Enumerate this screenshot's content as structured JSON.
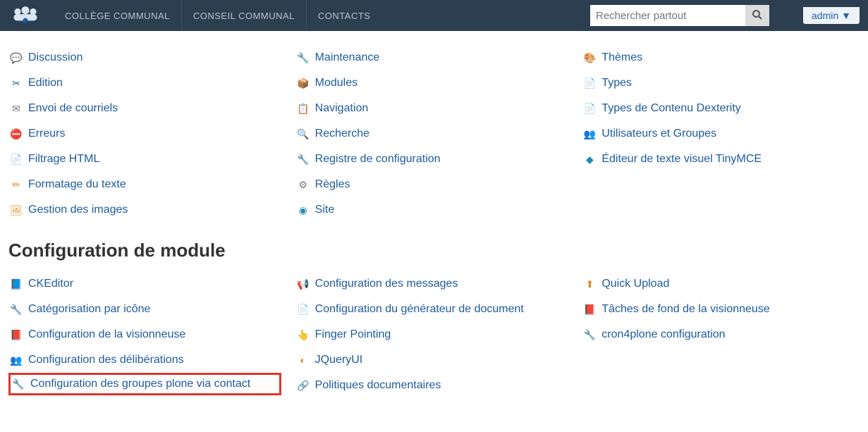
{
  "header": {
    "nav": [
      "COLLÈGE COMMUNAL",
      "CONSEIL COMMUNAL",
      "CONTACTS"
    ],
    "search_placeholder": "Rechercher partout",
    "user": "admin"
  },
  "section1": {
    "col1": [
      {
        "icon": "💬",
        "cls": "ic-blue",
        "name": "discussion",
        "label": "Discussion"
      },
      {
        "icon": "✂",
        "cls": "ic-blue",
        "name": "edition",
        "label": "Edition"
      },
      {
        "icon": "✉",
        "cls": "ic-grey",
        "name": "envoi-courriels",
        "label": "Envoi de courriels"
      },
      {
        "icon": "⛔",
        "cls": "ic-red",
        "name": "erreurs",
        "label": "Erreurs"
      },
      {
        "icon": "📄",
        "cls": "ic-blue",
        "name": "filtrage-html",
        "label": "Filtrage HTML"
      },
      {
        "icon": "✏",
        "cls": "ic-orange",
        "name": "formatage-texte",
        "label": "Formatage du texte"
      },
      {
        "icon": "🖼",
        "cls": "ic-orange",
        "name": "gestion-images",
        "label": "Gestion des images"
      }
    ],
    "col2": [
      {
        "icon": "🔧",
        "cls": "ic-wrench",
        "name": "maintenance",
        "label": "Maintenance"
      },
      {
        "icon": "📦",
        "cls": "ic-orange",
        "name": "modules",
        "label": "Modules"
      },
      {
        "icon": "📋",
        "cls": "ic-grey",
        "name": "navigation",
        "label": "Navigation"
      },
      {
        "icon": "🔍",
        "cls": "ic-grey",
        "name": "recherche",
        "label": "Recherche"
      },
      {
        "icon": "🔧",
        "cls": "ic-wrench",
        "name": "registre-config",
        "label": "Registre de configuration"
      },
      {
        "icon": "⚙",
        "cls": "ic-grey",
        "name": "regles",
        "label": "Règles"
      },
      {
        "icon": "◉",
        "cls": "ic-teal",
        "name": "site",
        "label": "Site"
      }
    ],
    "col3": [
      {
        "icon": "🎨",
        "cls": "ic-blue",
        "name": "themes",
        "label": "Thèmes"
      },
      {
        "icon": "📄",
        "cls": "ic-blue",
        "name": "types",
        "label": "Types"
      },
      {
        "icon": "📄",
        "cls": "ic-blue",
        "name": "types-dexterity",
        "label": "Types de Contenu Dexterity"
      },
      {
        "icon": "👥",
        "cls": "ic-orange",
        "name": "users-groups",
        "label": "Utilisateurs et Groupes"
      },
      {
        "icon": "◆",
        "cls": "ic-teal",
        "name": "tinymce",
        "label": "Éditeur de texte visuel TinyMCE"
      }
    ]
  },
  "section2": {
    "title": "Configuration de module",
    "col1": [
      {
        "icon": "📘",
        "cls": "ic-teal",
        "name": "ckeditor",
        "label": "CKEditor"
      },
      {
        "icon": "🔧",
        "cls": "ic-wrench",
        "name": "categorisation-icone",
        "label": "Catégorisation par icône"
      },
      {
        "icon": "📕",
        "cls": "ic-red",
        "name": "config-visionneuse",
        "label": "Configuration de la visionneuse"
      },
      {
        "icon": "👥",
        "cls": "ic-grey",
        "name": "config-deliberations",
        "label": "Configuration des délibérations"
      },
      {
        "icon": "🔧",
        "cls": "ic-wrench",
        "name": "config-groupes-plone",
        "label": "Configuration des groupes plone via contact",
        "highlight": true
      }
    ],
    "col2": [
      {
        "icon": "📢",
        "cls": "ic-grey",
        "name": "config-messages",
        "label": "Configuration des messages"
      },
      {
        "icon": "📄",
        "cls": "ic-blue",
        "name": "config-generateur-doc",
        "label": "Configuration du générateur de document"
      },
      {
        "icon": "👆",
        "cls": "ic-grey",
        "name": "finger-pointing",
        "label": "Finger Pointing"
      },
      {
        "icon": "◐",
        "cls": "ic-orange",
        "name": "jqueryui",
        "label": "JQueryUI"
      },
      {
        "icon": "🔗",
        "cls": "ic-grey",
        "name": "politiques-doc",
        "label": "Politiques documentaires"
      }
    ],
    "col3": [
      {
        "icon": "⬆",
        "cls": "ic-orange",
        "name": "quick-upload",
        "label": "Quick Upload"
      },
      {
        "icon": "📕",
        "cls": "ic-red",
        "name": "taches-fond",
        "label": "Tâches de fond de la visionneuse"
      },
      {
        "icon": "🔧",
        "cls": "ic-wrench",
        "name": "cron4plone",
        "label": "cron4plone configuration"
      }
    ]
  }
}
